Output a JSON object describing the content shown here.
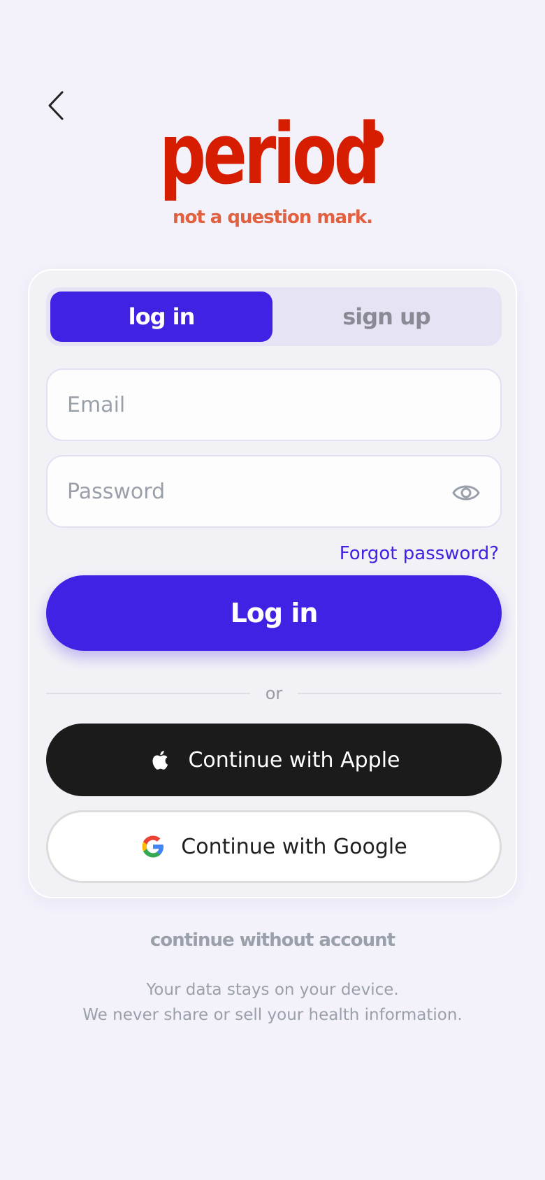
{
  "colors": {
    "accent": "#3f22e3",
    "brand_red": "#d71d00",
    "tagline": "#e0603f",
    "muted": "#9aa0aa"
  },
  "header": {
    "back_icon": "chevron-left-icon"
  },
  "brand": {
    "name": "period",
    "tagline": "not a question mark."
  },
  "tabs": [
    {
      "label": "log in",
      "active": true
    },
    {
      "label": "sign up",
      "active": false
    }
  ],
  "form": {
    "email_placeholder": "Email",
    "password_placeholder": "Password",
    "password_toggle_icon": "eye-icon",
    "forgot_label": "Forgot password?",
    "submit_label": "Log in"
  },
  "divider_label": "or",
  "social": {
    "apple_label": "Continue with Apple",
    "apple_icon": "apple-icon",
    "google_label": "Continue with Google",
    "google_icon": "google-icon"
  },
  "footer": {
    "skip_label": "continue without account",
    "privacy_line1": "Your data stays on your device.",
    "privacy_line2": "We never share or sell your health information."
  }
}
